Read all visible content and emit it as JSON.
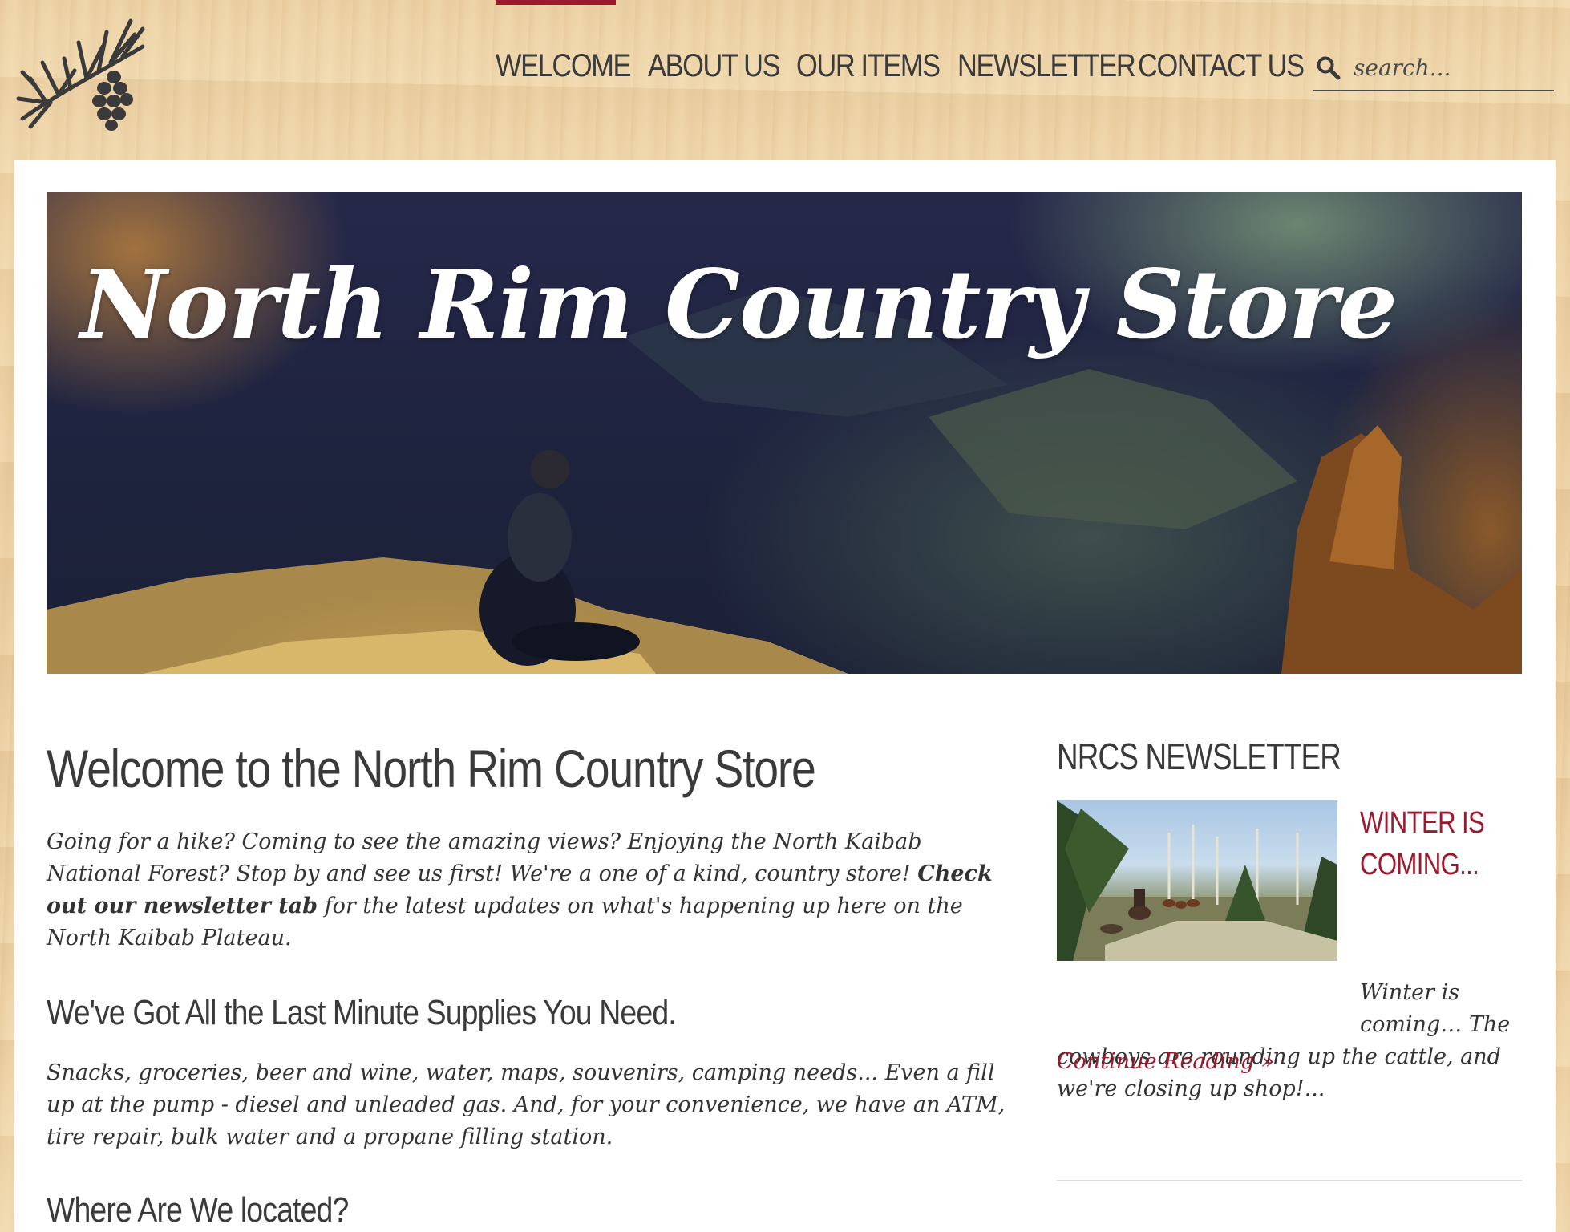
{
  "nav": {
    "items": [
      {
        "label": "WELCOME",
        "active": true
      },
      {
        "label": "ABOUT US",
        "active": false
      },
      {
        "label": "OUR ITEMS",
        "active": false
      },
      {
        "label": "NEWSLETTER",
        "active": false
      },
      {
        "label": "CONTACT US",
        "active": false
      }
    ],
    "active_color": "#9b1a2e"
  },
  "search": {
    "placeholder": "search...",
    "icon": "search-icon"
  },
  "logo": {
    "icon": "pine-branch-logo-icon"
  },
  "hero": {
    "title": "North Rim Country Store"
  },
  "main": {
    "welcome_heading": "Welcome to the North Rim Country Store",
    "intro_part1": "Going for a hike? Coming to see the amazing views? Enjoying the North Kaibab National Forest? Stop by and see us first! We're a one of a kind, country store! ",
    "intro_bold": "Check out our newsletter tab",
    "intro_part2": " for the latest updates on what's happening up here on the North Kaibab Plateau.",
    "supplies_heading": "We've Got All the Last Minute Supplies You Need.",
    "supplies_text": "Snacks, groceries, beer and wine, water, maps, souvenirs, camping needs... Even a fill up at the pump - diesel and unleaded gas. And, for your convenience, we have an ATM, tire repair, bulk water and a propane filling station.",
    "location_heading": "Where Are We located?"
  },
  "sidebar": {
    "heading": "NRCS NEWSLETTER",
    "post_title": "WINTER IS COMING...",
    "post_excerpt": "Winter is coming… The cowboys are rounding up the cattle, and we're closing up shop!...",
    "continue_label": "Continue Reading »"
  },
  "colors": {
    "accent": "#9b1a2e",
    "text": "#333333",
    "wood": "#edd2a6"
  }
}
